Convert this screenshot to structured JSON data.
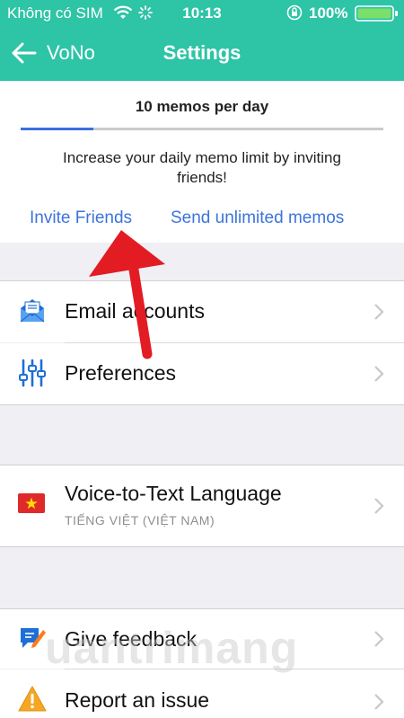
{
  "status_bar": {
    "carrier": "Không có SIM",
    "time": "10:13",
    "battery_percent": "100%"
  },
  "nav": {
    "back_label": "VoNo",
    "title": "Settings"
  },
  "memo_limit": {
    "count_label": "10 memos per day",
    "progress_fraction": 0.2,
    "description": "Increase your daily memo limit by inviting friends!",
    "invite_label": "Invite Friends",
    "unlimited_label": "Send unlimited memos"
  },
  "settings": {
    "email_accounts": "Email accounts",
    "preferences": "Preferences",
    "voice_language_title": "Voice-to-Text Language",
    "voice_language_value": "TIẾNG VIỆT (VIỆT NAM)",
    "give_feedback": "Give feedback",
    "report_issue": "Report an issue"
  },
  "watermark": "uantrimang",
  "colors": {
    "accent": "#2ec4a6",
    "link": "#3b74db",
    "progress": "#3b6fe0",
    "annotation_arrow": "#e31b23"
  },
  "icons": [
    "back-arrow-icon",
    "wifi-icon",
    "loading-icon",
    "orientation-lock-icon",
    "battery-icon",
    "email-icon",
    "sliders-icon",
    "vietnam-flag-icon",
    "feedback-icon",
    "warning-icon",
    "chevron-right-icon"
  ]
}
